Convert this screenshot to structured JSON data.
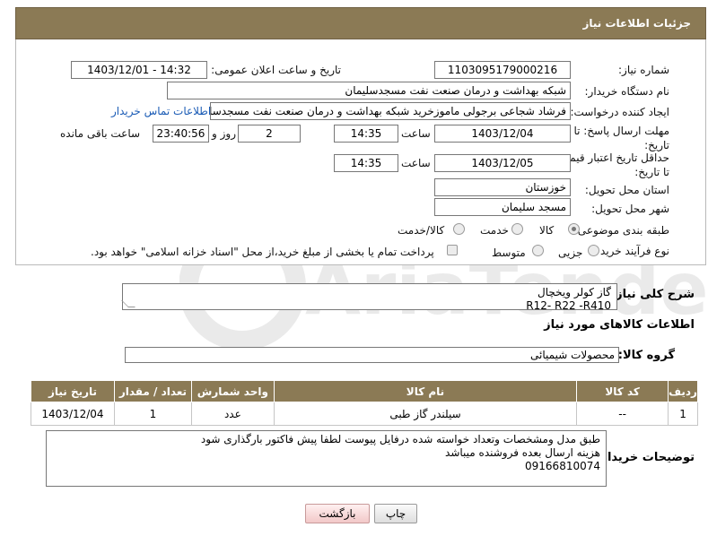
{
  "header": {
    "title": "جزئیات اطلاعات نیاز"
  },
  "fields": {
    "need_number": {
      "label": "شماره نیاز:",
      "value": "1103095179000216"
    },
    "announce_datetime": {
      "label": "تاریخ و ساعت اعلان عمومی:",
      "value": "1403/12/01 - 14:32"
    },
    "buyer_org": {
      "label": "نام دستگاه خریدار:",
      "value": "شبکه بهداشت و درمان صنعت نفت مسجدسلیمان"
    },
    "requester": {
      "label": "ایجاد کننده درخواست:",
      "value": "فرشاد شجاعی برجولی ماموزخرید شبکه بهداشت و درمان صنعت نفت مسجدسلیمان",
      "link": "اطلاعات تماس خریدار"
    },
    "reply_deadline": {
      "label": "مهلت ارسال پاسخ: تا تاریخ:",
      "date": "1403/12/04",
      "time_label": "ساعت",
      "time": "14:35",
      "days": "2",
      "days_label": "روز و",
      "remaining": "23:40:56",
      "remaining_label": "ساعت باقی مانده"
    },
    "price_validity": {
      "label": "حداقل تاریخ اعتبار قیمت: تا تاریخ:",
      "date": "1403/12/05",
      "time_label": "ساعت",
      "time": "14:35"
    },
    "province": {
      "label": "استان محل تحویل:",
      "value": "خوزستان"
    },
    "city": {
      "label": "شهر محل تحویل:",
      "value": "مسجد سلیمان"
    },
    "category": {
      "label": "طبقه بندی موضوعی:",
      "options": [
        "کالا",
        "خدمت",
        "کالا/خدمت"
      ],
      "selected": "کالا"
    },
    "purchase_process": {
      "label": "نوع فرآیند خرید :",
      "options": [
        "جزیی",
        "متوسط"
      ],
      "checkbox_text": "پرداخت تمام یا بخشی از مبلغ خرید،از محل \"اسناد خزانه اسلامی\" خواهد بود."
    }
  },
  "need_description": {
    "label": "شرح کلی نیاز:",
    "lines": [
      "گاز کولر ویخچال",
      "R12-  R22  -R410"
    ]
  },
  "goods_info": {
    "label": "اطلاعات کالاهای مورد نیاز"
  },
  "goods_group": {
    "label": "گروه کالا:",
    "value": "محصولات شیمیائی"
  },
  "table": {
    "headers": [
      "ردیف",
      "کد کالا",
      "نام کالا",
      "واحد شمارش",
      "تعداد / مقدار",
      "تاریخ نیاز"
    ],
    "rows": [
      [
        "1",
        "--",
        "سیلندر گاز طبی",
        "عدد",
        "1",
        "1403/12/04"
      ]
    ]
  },
  "buyer_notes": {
    "label": "توضیحات خریدار:",
    "lines": [
      "طبق مدل ومشخصات وتعداد خواسته شده درفایل پیوست لطفا پیش فاکتور بارگذاری شود",
      "هزینه ارسال بعده فروشنده میباشد",
      "09166810074"
    ]
  },
  "buttons": {
    "print": "چاپ",
    "back": "بازگشت"
  },
  "watermark_text": "AriaTender.net",
  "colors": {
    "header_bg": "#8b7a55",
    "link": "#1a5bb5"
  }
}
